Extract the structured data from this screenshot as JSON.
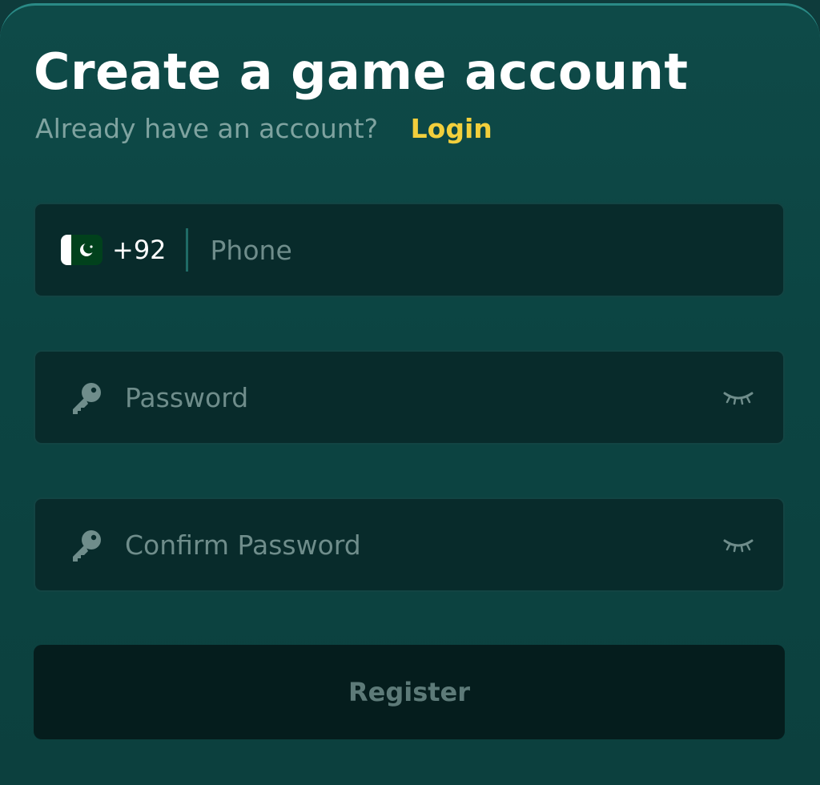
{
  "header": {
    "title": "Create a game account",
    "subtitle": "Already have an account?",
    "login_link": "Login"
  },
  "phone_field": {
    "country_flag": "pakistan-flag-icon",
    "country_code": "+92",
    "placeholder": "Phone",
    "value": ""
  },
  "password_field": {
    "icon": "key-icon",
    "placeholder": "Password",
    "value": "",
    "toggle_icon": "eye-closed-icon"
  },
  "confirm_password_field": {
    "icon": "key-icon",
    "placeholder": "Confirm Password",
    "value": "",
    "toggle_icon": "eye-closed-icon"
  },
  "register_button": {
    "label": "Register"
  },
  "colors": {
    "accent_link": "#f2cf3c",
    "card_background": "#0c4442",
    "field_background": "#082b2b",
    "button_background": "#051d1d"
  }
}
